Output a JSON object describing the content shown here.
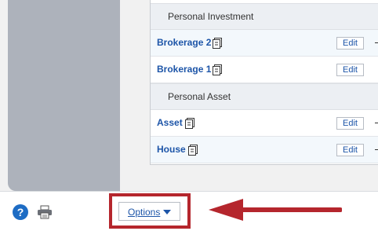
{
  "accounts": {
    "groups": [
      {
        "title": "Personal Investment",
        "items": [
          {
            "name": "Brokerage 2",
            "edit": "Edit"
          },
          {
            "name": "Brokerage 1",
            "edit": "Edit"
          }
        ]
      },
      {
        "title": "Personal Asset",
        "items": [
          {
            "name": "Asset",
            "edit": "Edit"
          },
          {
            "name": "House",
            "edit": "Edit"
          }
        ]
      }
    ]
  },
  "footer": {
    "help_icon": "help-icon",
    "help_glyph": "?",
    "print_icon": "printer-icon",
    "options_label": "Options",
    "options_icon": "caret-down-icon"
  },
  "annotation": {
    "highlight_color": "#b5262d"
  },
  "colors": {
    "link": "#1d55a8",
    "sidebar": "#adb2bb",
    "help": "#1d6cc4"
  }
}
